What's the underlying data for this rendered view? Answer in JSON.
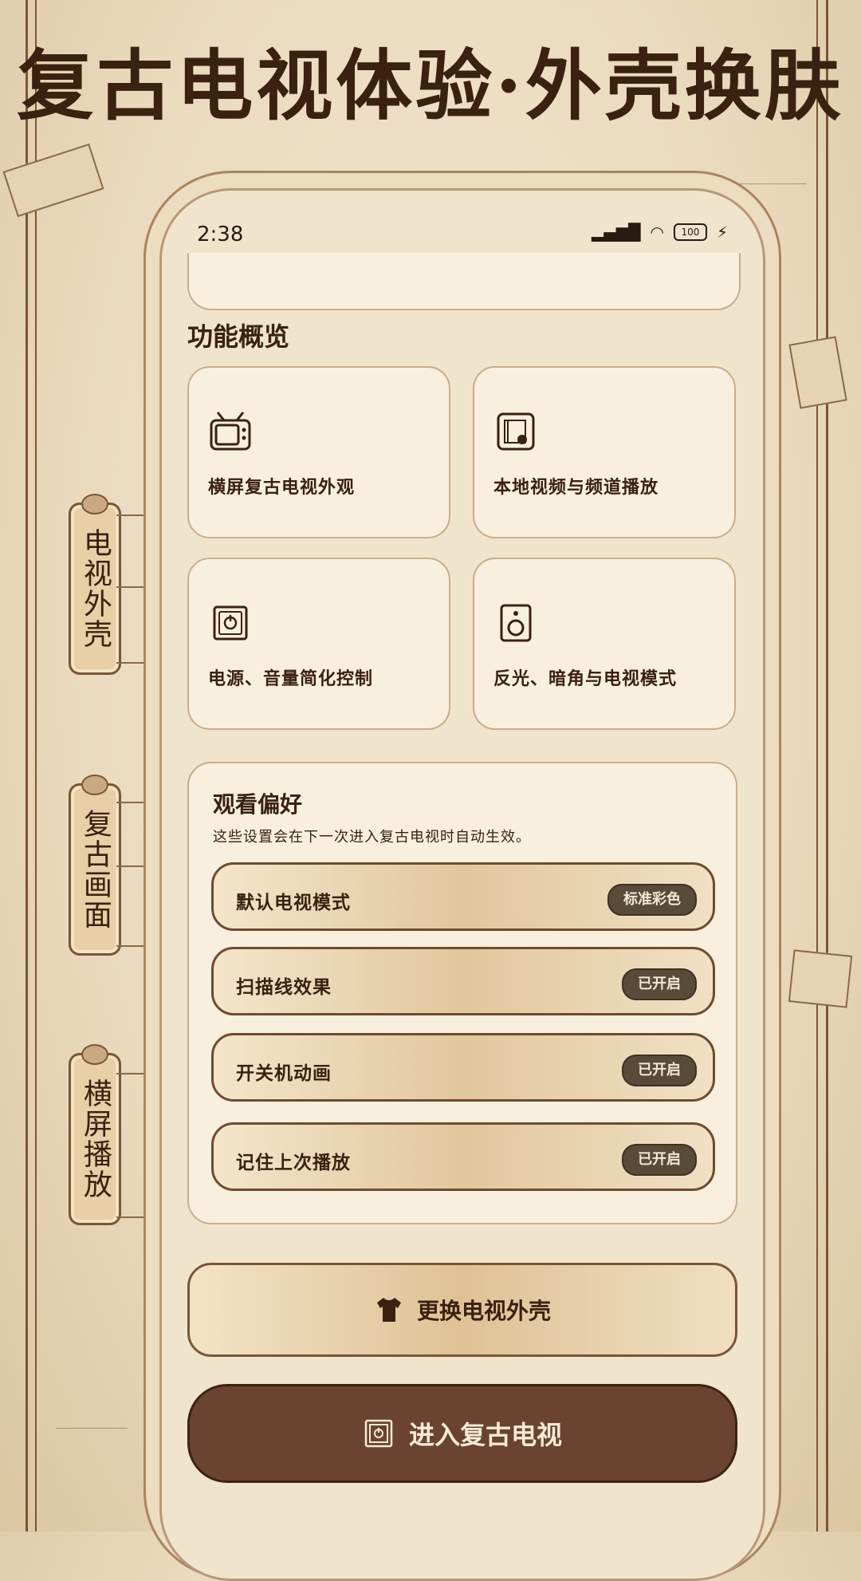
{
  "page": {
    "title": "复古电视体验·外壳换肤"
  },
  "side_tabs": [
    "电视外壳",
    "复古画面",
    "横屏播放"
  ],
  "status_bar": {
    "time": "2:38",
    "battery": "100"
  },
  "overview": {
    "title": "功能概览",
    "features": [
      {
        "label": "横屏复古电视外观",
        "icon": "tv-icon"
      },
      {
        "label": "本地视频与频道播放",
        "icon": "video-file-icon"
      },
      {
        "label": "电源、音量简化控制",
        "icon": "power-control-icon"
      },
      {
        "label": "反光、暗角与电视模式",
        "icon": "speaker-icon"
      }
    ]
  },
  "preferences": {
    "title": "观看偏好",
    "subtitle": "这些设置会在下一次进入复古电视时自动生效。",
    "rows": [
      {
        "name": "默认电视模式",
        "value": "标准彩色"
      },
      {
        "name": "扫描线效果",
        "value": "已开启"
      },
      {
        "name": "开关机动画",
        "value": "已开启"
      },
      {
        "name": "记住上次播放",
        "value": "已开启"
      }
    ]
  },
  "actions": {
    "change_skin": "更换电视外壳",
    "enter_tv": "进入复古电视"
  },
  "colors": {
    "accent_dark": "#6a4430",
    "paper": "#f1e4cc",
    "border": "#7a5636"
  }
}
